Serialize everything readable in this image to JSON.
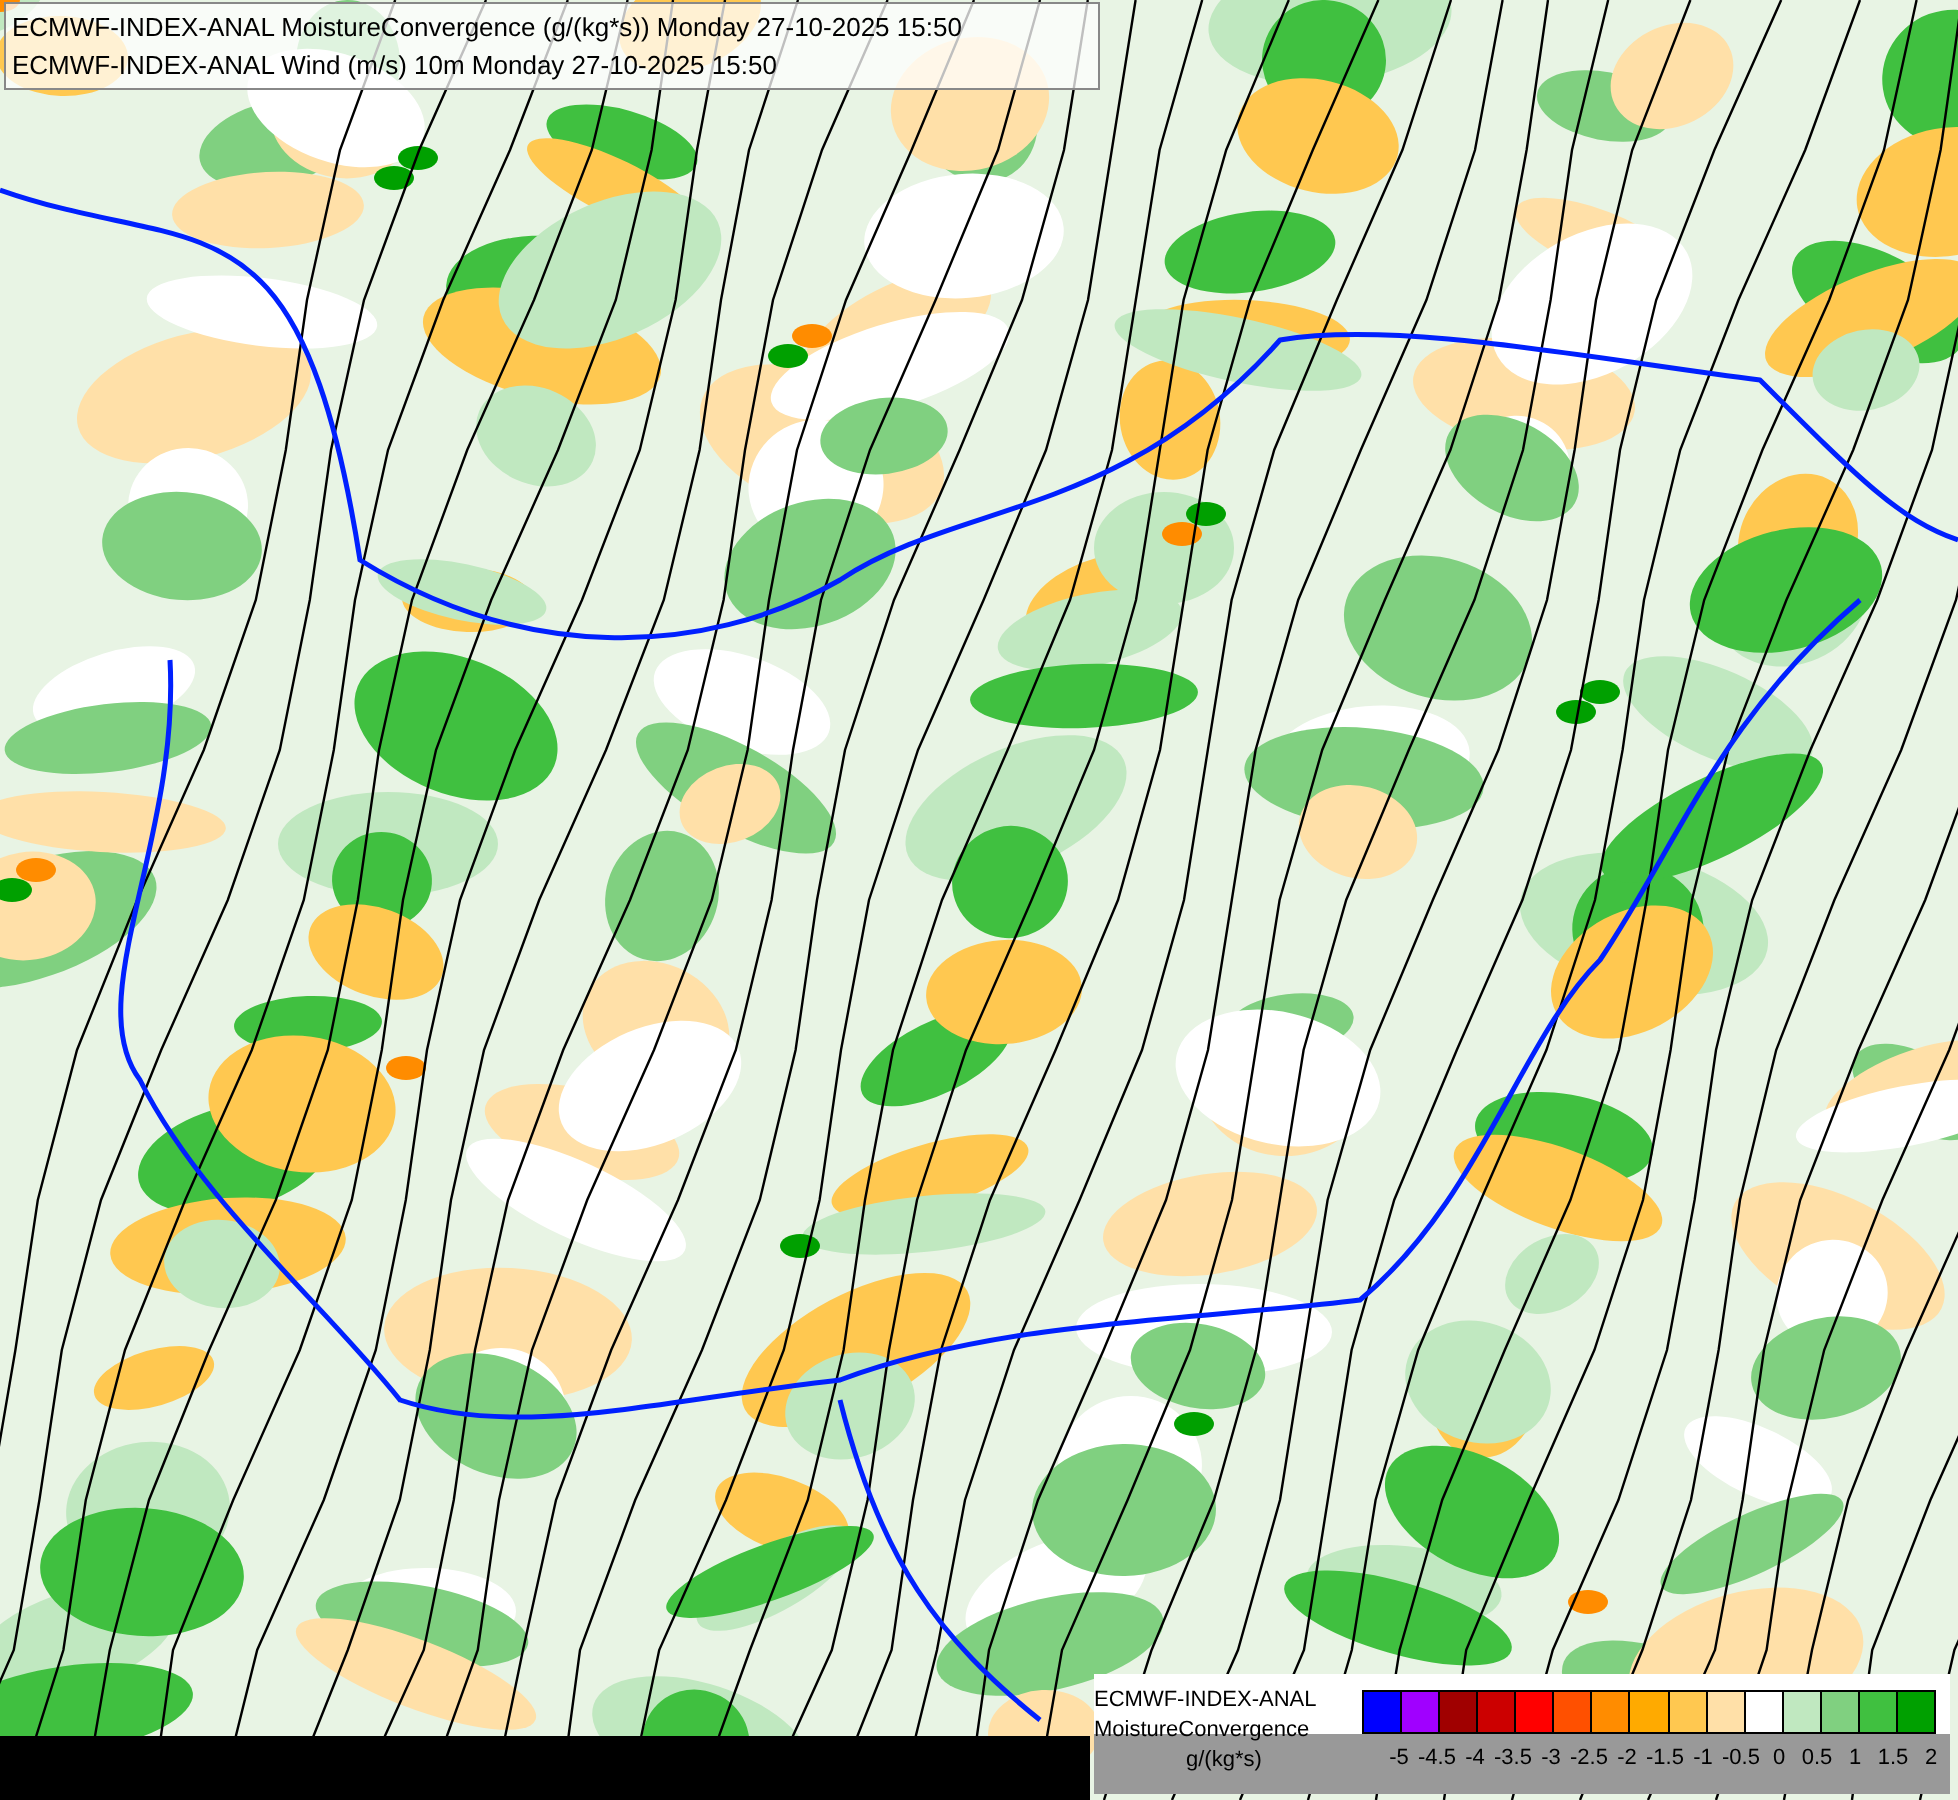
{
  "titles": [
    "ECMWF-INDEX-ANAL MoistureConvergence (g/(kg*s)) Monday 27-10-2025 15:50",
    "ECMWF-INDEX-ANAL Wind (m/s) 10m Monday 27-10-2025 15:50"
  ],
  "legend": {
    "source": "ECMWF-INDEX-ANAL",
    "parameter": "MoistureConvergence",
    "unit": "g/(kg*s)",
    "swatches": [
      {
        "color": "#0000ff"
      },
      {
        "color": "#a000ff"
      },
      {
        "color": "#a00000"
      },
      {
        "color": "#cc0000"
      },
      {
        "color": "#ff0000"
      },
      {
        "color": "#ff5000"
      },
      {
        "color": "#ff8c00"
      },
      {
        "color": "#ffaa00"
      },
      {
        "color": "#ffc850"
      },
      {
        "color": "#ffe0a8"
      },
      {
        "color": "#ffffff"
      },
      {
        "color": "#c0e8c0"
      },
      {
        "color": "#80d080"
      },
      {
        "color": "#40c040"
      },
      {
        "color": "#00a000"
      }
    ],
    "ticks": [
      "-5",
      "-4.5",
      "-4",
      "-3.5",
      "-3",
      "-2.5",
      "-2",
      "-1.5",
      "-1",
      "-0.5",
      "0",
      "0.5",
      "1",
      "1.5",
      "2"
    ]
  }
}
